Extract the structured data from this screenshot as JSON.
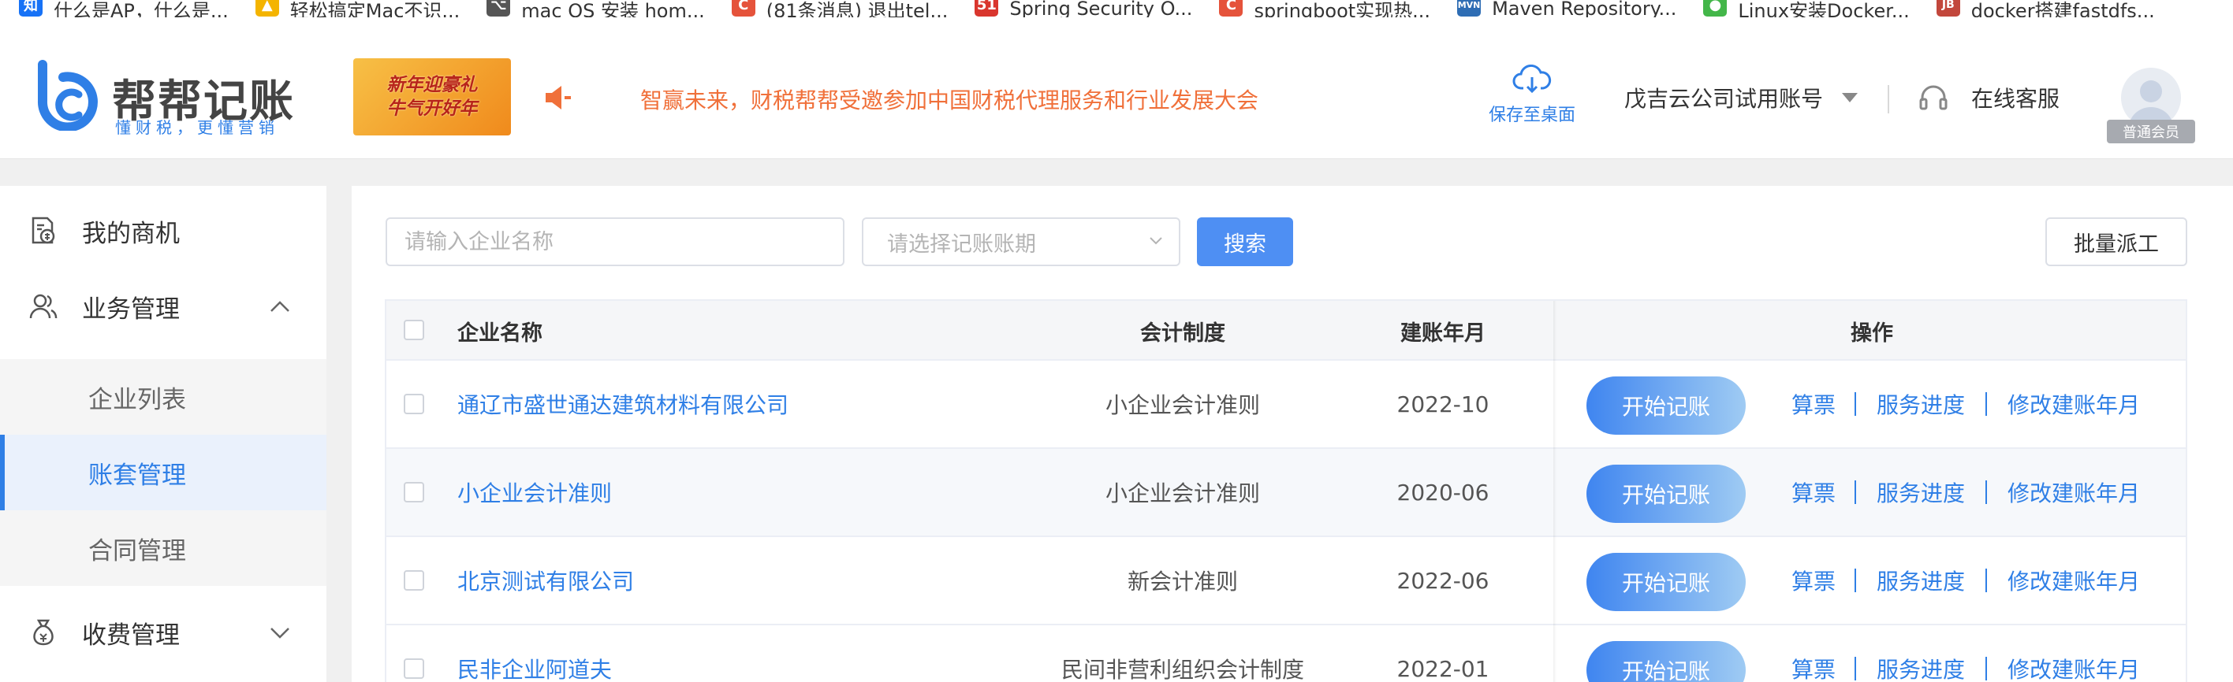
{
  "bookmarks": [
    {
      "icon": "知",
      "label": "什么是AP，什么是...",
      "color": "#1772f6"
    },
    {
      "icon": "▲",
      "label": "轻松搞定Mac不识...",
      "color": "#f4b400"
    },
    {
      "icon": "⌥",
      "label": "mac OS 安装 hom...",
      "color": "#555555"
    },
    {
      "icon": "C",
      "label": "(81条消息) 退出tel...",
      "color": "#e5533b"
    },
    {
      "icon": "51",
      "label": "Spring Security O...",
      "color": "#d9362e"
    },
    {
      "icon": "C",
      "label": "springboot实现热...",
      "color": "#e5533b"
    },
    {
      "icon": "MVN",
      "label": "Maven Repository...",
      "color": "#2e6db4"
    },
    {
      "icon": "●",
      "label": "Linux安装Docker...",
      "color": "#43b649"
    },
    {
      "icon": "JB",
      "label": "docker搭建fastdfs...",
      "color": "#c2473c"
    }
  ],
  "header": {
    "logo_title": "帮帮记账",
    "logo_subtitle": "懂财税，更懂营销",
    "promo_line1": "新年迎豪礼",
    "promo_line2": "牛气开好年",
    "notice": "智赢未来，财税帮帮受邀参加中国财税代理服务和行业发展大会",
    "save_to_desktop": "保存至桌面",
    "account_name": "戊吉云公司试用账号",
    "online_service": "在线客服",
    "member_level": "普通会员",
    "accent_color": "#2f7fe6",
    "notice_color": "#f0703a"
  },
  "sidebar": {
    "items": [
      {
        "label": "我的商机",
        "icon": "document-money-icon"
      },
      {
        "label": "业务管理",
        "icon": "users-icon",
        "expanded": true
      },
      {
        "label": "收费管理",
        "icon": "money-bag-icon",
        "expanded": false
      }
    ],
    "sub_items": [
      {
        "label": "企业列表",
        "active": false
      },
      {
        "label": "账套管理",
        "active": true
      },
      {
        "label": "合同管理",
        "active": false
      }
    ]
  },
  "toolbar": {
    "company_placeholder": "请输入企业名称",
    "period_placeholder": "请选择记账账期",
    "search_label": "搜索",
    "batch_label": "批量派工"
  },
  "table": {
    "headers": {
      "name": "企业名称",
      "system": "会计制度",
      "date": "建账年月",
      "ops": "操作"
    },
    "rows": [
      {
        "name": "通辽市盛世通达建筑材料有限公司",
        "system": "小企业会计准则",
        "date": "2022-10"
      },
      {
        "name": "小企业会计准则",
        "system": "小企业会计准则",
        "date": "2020-06"
      },
      {
        "name": "北京测试有限公司",
        "system": "新会计准则",
        "date": "2022-06"
      },
      {
        "name": "民非企业阿道夫",
        "system": "民间非营利组织会计制度",
        "date": "2022-01"
      }
    ],
    "actions": {
      "start": "开始记账",
      "calc": "算票",
      "progress": "服务进度",
      "edit": "修改建账年月"
    }
  }
}
